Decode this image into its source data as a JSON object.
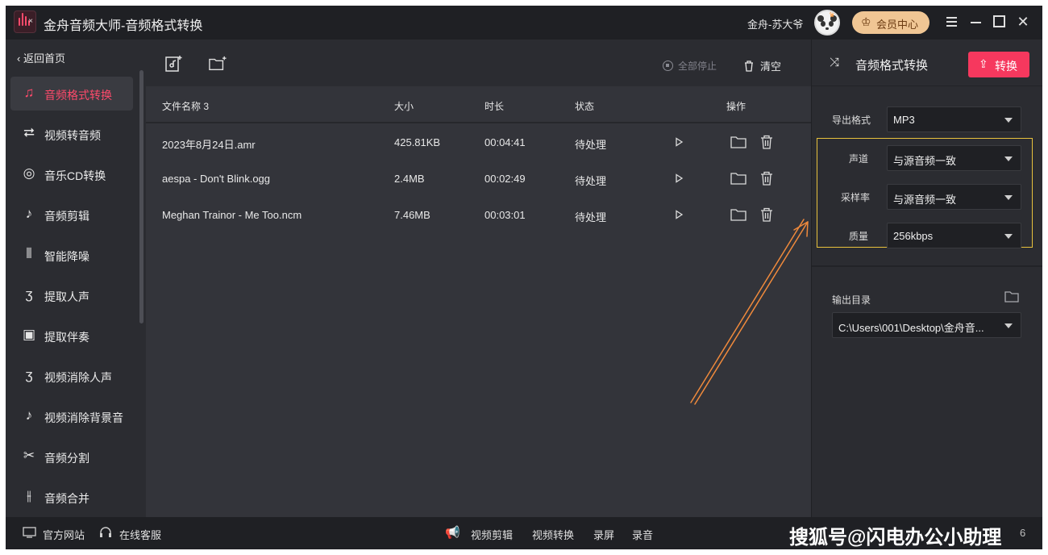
{
  "window": {
    "title": "金舟音频大师-音频格式转换",
    "user_name": "金舟-苏大爷",
    "vip_label": "会员中心"
  },
  "sidebar": {
    "back_label": "返回首页",
    "items": [
      {
        "label": "音频格式转换",
        "icon": "audio-convert-icon",
        "glyph": "♫",
        "active": true
      },
      {
        "label": "视频转音频",
        "icon": "video-to-audio-icon",
        "glyph": "⮂",
        "active": false
      },
      {
        "label": "音乐CD转换",
        "icon": "cd-icon",
        "glyph": "◎",
        "active": false
      },
      {
        "label": "音频剪辑",
        "icon": "audio-cut-icon",
        "glyph": "♪",
        "active": false
      },
      {
        "label": "智能降噪",
        "icon": "denoise-icon",
        "glyph": "⦀",
        "active": false
      },
      {
        "label": "提取人声",
        "icon": "voice-extract-icon",
        "glyph": "ʒ",
        "active": false
      },
      {
        "label": "提取伴奏",
        "icon": "accompaniment-icon",
        "glyph": "▣",
        "active": false
      },
      {
        "label": "视频消除人声",
        "icon": "remove-voice-icon",
        "glyph": "ʒ",
        "active": false
      },
      {
        "label": "视频消除背景音",
        "icon": "remove-bgm-icon",
        "glyph": "♪",
        "active": false
      },
      {
        "label": "音频分割",
        "icon": "scissors-icon",
        "glyph": "✂",
        "active": false
      },
      {
        "label": "音频合并",
        "icon": "merge-icon",
        "glyph": "⫲",
        "active": false
      }
    ]
  },
  "toolbar": {
    "stop_all_label": "全部停止",
    "clear_label": "清空"
  },
  "table": {
    "headers": {
      "name": "文件名称 3",
      "size": "大小",
      "duration": "时长",
      "status": "状态",
      "actions": "操作"
    },
    "rows": [
      {
        "name": "2023年8月24日.amr",
        "size": "425.81KB",
        "duration": "00:04:41",
        "status": "待处理"
      },
      {
        "name": "aespa - Don't Blink.ogg",
        "size": "2.4MB",
        "duration": "00:02:49",
        "status": "待处理"
      },
      {
        "name": "Meghan Trainor - Me Too.ncm",
        "size": "7.46MB",
        "duration": "00:03:01",
        "status": "待处理"
      }
    ]
  },
  "right_panel": {
    "title": "音频格式转换",
    "convert_label": "转换",
    "export_format_label": "导出格式",
    "export_format_value": "MP3",
    "channel_label": "声道",
    "channel_value": "与源音频一致",
    "sample_rate_label": "采样率",
    "sample_rate_value": "与源音频一致",
    "quality_label": "质量",
    "quality_value": "256kbps",
    "output_dir_label": "输出目录",
    "output_dir_value": "C:\\Users\\001\\Desktop\\金舟音...",
    "highlight_color": "#e8c23d"
  },
  "bottom_bar": {
    "website_label": "官方网站",
    "service_label": "在线客服",
    "video_edit_label": "视频剪辑",
    "video_convert_label": "视频转换",
    "record_screen_label": "录屏",
    "record_audio_label": "录音",
    "watermark": "搜狐号@闪电办公小助理",
    "watermark_tail": "6"
  },
  "colors": {
    "accent": "#f6385e",
    "background": "#2b2c31",
    "annotation_arrow": "#f08a3c"
  }
}
